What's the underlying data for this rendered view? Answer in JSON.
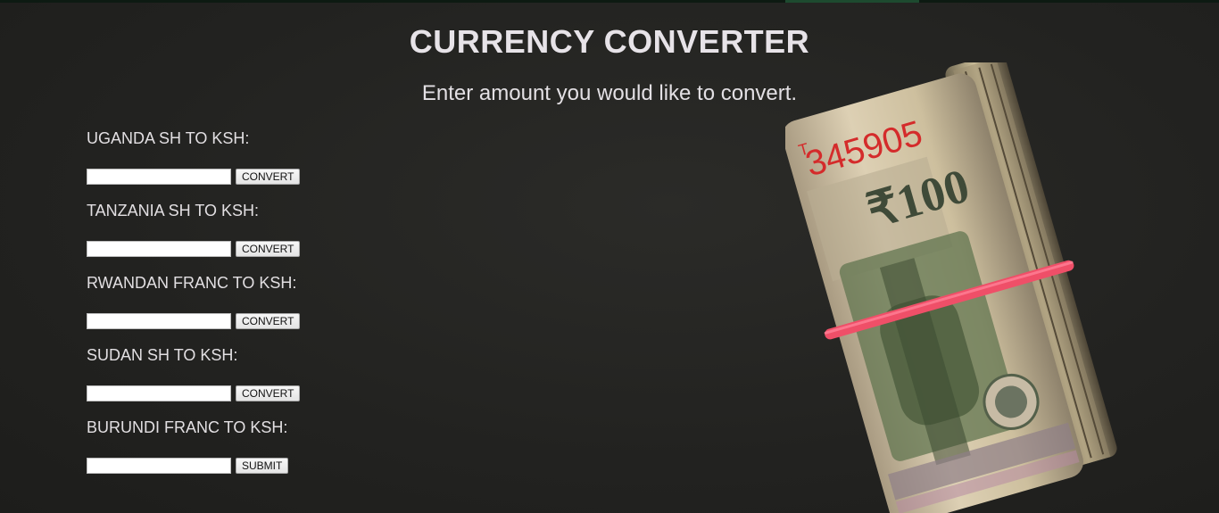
{
  "header": {
    "title": "CURRENCY CONVERTER",
    "subtitle": "Enter amount you would like to convert."
  },
  "converters": [
    {
      "label": "UGANDA SH TO KSH:",
      "value": "",
      "button": "CONVERT"
    },
    {
      "label": "TANZANIA SH TO KSH:",
      "value": "",
      "button": "CONVERT"
    },
    {
      "label": "RWANDAN FRANC TO KSH:",
      "value": "",
      "button": "CONVERT"
    },
    {
      "label": "SUDAN SH TO KSH:",
      "value": "",
      "button": "CONVERT"
    },
    {
      "label": "BURUNDI FRANC TO KSH:",
      "value": "",
      "button": "SUBMIT"
    }
  ],
  "background_image": {
    "serial": "345905",
    "denomination": "100",
    "band_color": "#f0506a"
  },
  "colors": {
    "background": "#262624",
    "text": "#e4e1e5"
  }
}
